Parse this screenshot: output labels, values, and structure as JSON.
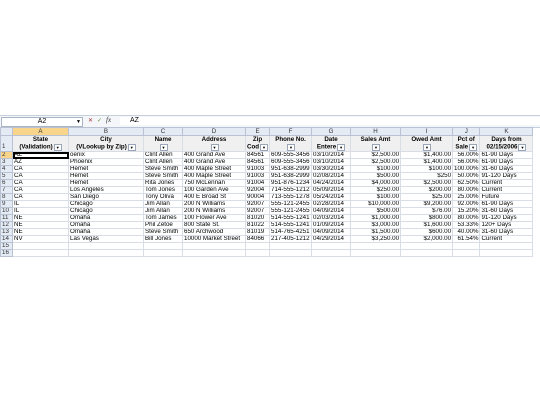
{
  "formula_bar": {
    "name_box": "A2",
    "fx_label": "fx",
    "value": "AZ"
  },
  "columns": [
    "A",
    "B",
    "C",
    "D",
    "E",
    "F",
    "G",
    "H",
    "I",
    "J",
    "K"
  ],
  "header_row": {
    "row_num": "1",
    "cells": [
      [
        "State",
        "(Validation)"
      ],
      [
        "City",
        "(VLookup by Zip)"
      ],
      [
        "Name",
        ""
      ],
      [
        "Address",
        ""
      ],
      [
        "Zip",
        "Cod"
      ],
      [
        "Phone No.",
        ""
      ],
      [
        "Date",
        "Entere"
      ],
      [
        "Sales Amt",
        ""
      ],
      [
        "Owed Amt",
        ""
      ],
      [
        "Pct of",
        "Sale"
      ],
      [
        "Days from",
        "02/15/2006"
      ]
    ]
  },
  "rows": [
    {
      "n": "2",
      "c": [
        "AZ",
        "oenix",
        "Clint Allen",
        "400 Grand Ave",
        "84561",
        "609-555-3456",
        "03/10/2014",
        "$2,500.00",
        "$1,400.00",
        "56.00%",
        "61-90 Days"
      ]
    },
    {
      "n": "3",
      "c": [
        "AZ",
        "Phoenix",
        "Clint Allen",
        "400 Grand Ave",
        "84561",
        "609-555-3456",
        "03/10/2014",
        "$2,500.00",
        "$1,400.00",
        "56.00%",
        "61-90 Days"
      ]
    },
    {
      "n": "4",
      "c": [
        "CA",
        "Hemet",
        "Steve Smith",
        "400 Maple Street",
        "91003",
        "951-638-2999",
        "03/30/2014",
        "$100.00",
        "$100.00",
        "100.00%",
        "31-60 Days"
      ]
    },
    {
      "n": "5",
      "c": [
        "CA",
        "Hemet",
        "Steve Smith",
        "400 Maple Street",
        "91003",
        "951-638-2999",
        "02/08/2014",
        "$500.00",
        "$250",
        "50.00%",
        "91-120 Days"
      ]
    },
    {
      "n": "6",
      "c": [
        "CA",
        "Hemet",
        "Rita Jones",
        "750 McLennan",
        "91004",
        "951-876-1234",
        "04/24/2014",
        "$4,000.00",
        "$2,500.00",
        "62.50%",
        "Current"
      ]
    },
    {
      "n": "7",
      "c": [
        "CA",
        "Los Angeles",
        "Tom Jones",
        "100 Garden Ave",
        "92004",
        "714-555-1212",
        "05/09/2014",
        "$250.00",
        "$200.00",
        "80.00%",
        "Current"
      ]
    },
    {
      "n": "8",
      "c": [
        "CA",
        "San Diego",
        "Tony Oliva",
        "400 E Broad St",
        "90004",
        "713-555-1278",
        "05/24/2014",
        "$100.00",
        "$25.00",
        "25.00%",
        "Future"
      ]
    },
    {
      "n": "9",
      "c": [
        "IL",
        "Chicago",
        "Jim Allan",
        "200 N Williams",
        "92007",
        "555-121-2455",
        "02/28/2014",
        "$10,000.00",
        "$9,200.00",
        "92.00%",
        "61-90 Days"
      ]
    },
    {
      "n": "10",
      "c": [
        "IL",
        "Chicago",
        "Jim Allan",
        "200 N Williams",
        "92007",
        "555-121-2455",
        "04/09/2014",
        "$500.00",
        "$76.00",
        "15.20%",
        "31-60 Days"
      ]
    },
    {
      "n": "11",
      "c": [
        "NE",
        "Omaha",
        "Tom James",
        "100 Flower Ave",
        "81020",
        "514-555-1241",
        "02/03/2014",
        "$1,000.00",
        "$800.00",
        "80.00%",
        "91-120 Days"
      ]
    },
    {
      "n": "12",
      "c": [
        "NE",
        "Omaha",
        "Phil Zetoe",
        "800 State St.",
        "81022",
        "514-555-1241",
        "01/09/2014",
        "$3,000.00",
        "$1,600.00",
        "53.33%",
        "120+ Days"
      ]
    },
    {
      "n": "13",
      "c": [
        "NE",
        "Omaha",
        "Steve Smith",
        "650 Archwood",
        "81019",
        "514-765-4251",
        "04/09/2014",
        "$1,500.00",
        "$600.00",
        "40.00%",
        "31-60 Days"
      ]
    },
    {
      "n": "14",
      "c": [
        "NV",
        "Las Vegas",
        "Bill Jones",
        "10000 Market Street",
        "84066",
        "217-405-1212",
        "04/29/2014",
        "$3,250.00",
        "$2,000.00",
        "61.54%",
        "Current"
      ]
    }
  ],
  "empty_rows": [
    "15",
    "16"
  ]
}
